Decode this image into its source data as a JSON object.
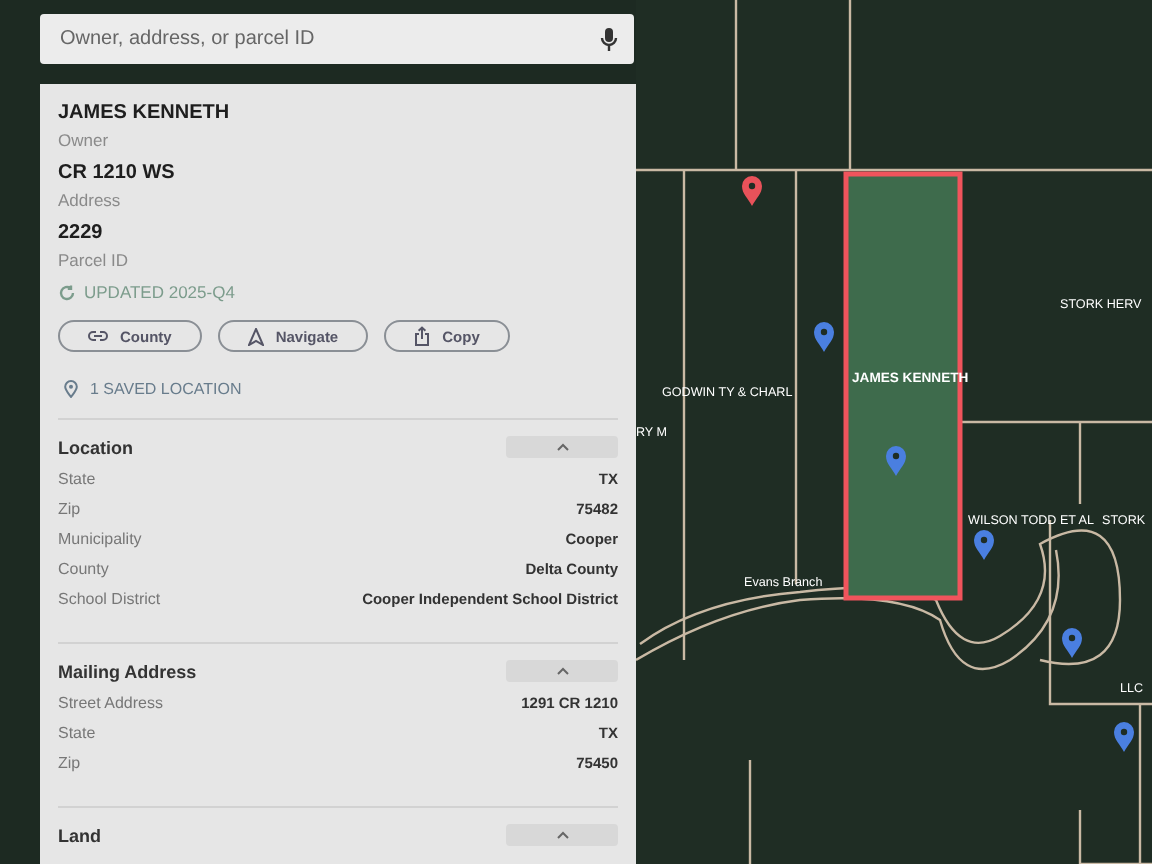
{
  "search": {
    "placeholder": "Owner, address, or parcel ID"
  },
  "summary": [
    {
      "value": "JAMES KENNETH",
      "label": "Owner"
    },
    {
      "value": "CR 1210 WS",
      "label": "Address"
    },
    {
      "value": "2229",
      "label": "Parcel ID"
    }
  ],
  "updated": "UPDATED 2025-Q4",
  "actions": [
    {
      "kind": "link",
      "label": "County"
    },
    {
      "kind": "navigate",
      "label": "Navigate"
    },
    {
      "kind": "share",
      "label": "Copy"
    }
  ],
  "saved": "1 SAVED LOCATION",
  "sections": [
    {
      "title": "Location",
      "expanded": true,
      "rows": [
        {
          "label": "State",
          "value": "TX"
        },
        {
          "label": "Zip",
          "value": "75482"
        },
        {
          "label": "Municipality",
          "value": "Cooper"
        },
        {
          "label": "County",
          "value": "Delta County"
        },
        {
          "label": "School District",
          "value": "Cooper Independent School District"
        }
      ]
    },
    {
      "title": "Mailing Address",
      "expanded": true,
      "rows": [
        {
          "label": "Street Address",
          "value": "1291 CR 1210"
        },
        {
          "label": "State",
          "value": "TX"
        },
        {
          "label": "Zip",
          "value": "75450"
        }
      ]
    },
    {
      "title": "Land",
      "expanded": true
    }
  ],
  "map": {
    "labels": [
      {
        "text": "GODWIN TY & CHARL",
        "selected": false
      },
      {
        "text": "RY M",
        "selected": false
      },
      {
        "text": "JAMES KENNETH",
        "selected": true
      },
      {
        "text": "STORK HERV",
        "selected": false
      },
      {
        "text": "WILSON TODD ET AL",
        "selected": false
      },
      {
        "text": "STORK",
        "selected": false
      },
      {
        "text": "Evans Branch",
        "selected": false
      },
      {
        "text": "LLC",
        "selected": false
      }
    ],
    "pins": [
      {
        "color": "#e8525a"
      },
      {
        "color": "#4a7fe0"
      },
      {
        "color": "#4a7fe0"
      },
      {
        "color": "#4a7fe0"
      },
      {
        "color": "#4a7fe0"
      },
      {
        "color": "#4a7fe0"
      }
    ]
  }
}
